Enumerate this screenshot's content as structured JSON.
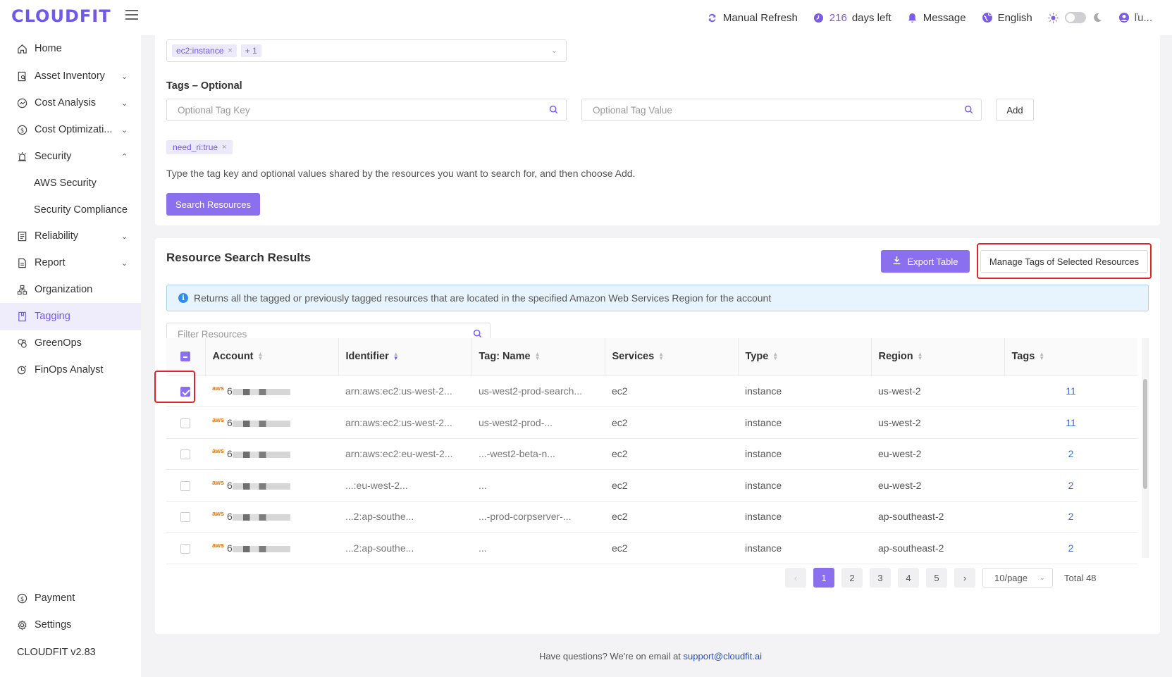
{
  "header": {
    "logo": "CLOUDFIT",
    "refresh_label": "Manual Refresh",
    "days_count": "216",
    "days_label": "days left",
    "message_label": "Message",
    "language_label": "English",
    "user_label": "ľu..."
  },
  "sidebar": {
    "items": [
      {
        "label": "Home",
        "icon": "home-icon"
      },
      {
        "label": "Asset Inventory",
        "icon": "inventory-icon"
      },
      {
        "label": "Cost Analysis",
        "icon": "chart-icon"
      },
      {
        "label": "Cost Optimizati...",
        "icon": "dollar-icon"
      },
      {
        "label": "Security",
        "icon": "alarm-icon"
      },
      {
        "label": "AWS Security"
      },
      {
        "label": "Security Compliance"
      },
      {
        "label": "Reliability",
        "icon": "document-icon"
      },
      {
        "label": "Report",
        "icon": "report-icon"
      },
      {
        "label": "Organization",
        "icon": "org-icon"
      },
      {
        "label": "Tagging",
        "icon": "bookmark-icon"
      },
      {
        "label": "GreenOps",
        "icon": "leaf-icon"
      },
      {
        "label": "FinOps Analyst",
        "icon": "analyst-icon"
      },
      {
        "label": "Payment",
        "icon": "dollar-icon"
      },
      {
        "label": "Settings",
        "icon": "gear-icon"
      }
    ],
    "version": "CLOUDFIT v2.83"
  },
  "filters": {
    "resource_types": [
      "ec2:instance"
    ],
    "more_count": "+ 1",
    "tags_title": "Tags – Optional",
    "tag_key_placeholder": "Optional Tag Key",
    "tag_value_placeholder": "Optional Tag Value",
    "add_label": "Add",
    "selected_tag": "need_ri:true",
    "helper": "Type the tag key and optional values shared by the resources you want to search for, and then choose Add.",
    "search_label": "Search Resources"
  },
  "results": {
    "title": "Resource Search Results",
    "export_label": "Export Table",
    "manage_label": "Manage Tags of Selected Resources",
    "info": "Returns all the tagged or previously tagged resources that are located in the specified Amazon Web Services Region for the account",
    "filter_placeholder": "Filter Resources",
    "columns": [
      "Account",
      "Identifier",
      "Tag: Name",
      "Services",
      "Type",
      "Region",
      "Tags"
    ],
    "rows": [
      {
        "checked": true,
        "account_prefix": "aws",
        "account": "6",
        "identifier": "arn:aws:ec2:us-west-2...",
        "tag_name": "us-west2-prod-search...",
        "service": "ec2",
        "type": "instance",
        "region": "us-west-2",
        "tags": "11"
      },
      {
        "checked": false,
        "account_prefix": "aws",
        "account": "6",
        "identifier": "arn:aws:ec2:us-west-2...",
        "tag_name": "us-west2-prod-...",
        "service": "ec2",
        "type": "instance",
        "region": "us-west-2",
        "tags": "11"
      },
      {
        "checked": false,
        "account_prefix": "aws",
        "account": "6",
        "identifier": "arn:aws:ec2:eu-west-2...",
        "tag_name": "...-west2-beta-n...",
        "service": "ec2",
        "type": "instance",
        "region": "eu-west-2",
        "tags": "2"
      },
      {
        "checked": false,
        "account_prefix": "aws",
        "account": "6",
        "identifier": "...:eu-west-2...",
        "tag_name": "...",
        "service": "ec2",
        "type": "instance",
        "region": "eu-west-2",
        "tags": "2"
      },
      {
        "checked": false,
        "account_prefix": "aws",
        "account": "6",
        "identifier": "...2:ap-southe...",
        "tag_name": "...-prod-corpserver-...",
        "service": "ec2",
        "type": "instance",
        "region": "ap-southeast-2",
        "tags": "2"
      },
      {
        "checked": false,
        "account_prefix": "aws",
        "account": "6",
        "identifier": "...2:ap-southe...",
        "tag_name": "...",
        "service": "ec2",
        "type": "instance",
        "region": "ap-southeast-2",
        "tags": "2"
      }
    ]
  },
  "pagination": {
    "prev": "‹",
    "pages": [
      "1",
      "2",
      "3",
      "4",
      "5"
    ],
    "next": "›",
    "page_size": "10/page",
    "total": "Total 48"
  },
  "footer": {
    "text": "Have questions? We're on email at",
    "email": "support@cloudfit.ai"
  },
  "colors": {
    "accent": "#7b5ce5",
    "primary_button": "#8a70ee",
    "highlight_box": "#e02424",
    "info_background": "#e8f4fd",
    "link": "#3d6fd8"
  }
}
